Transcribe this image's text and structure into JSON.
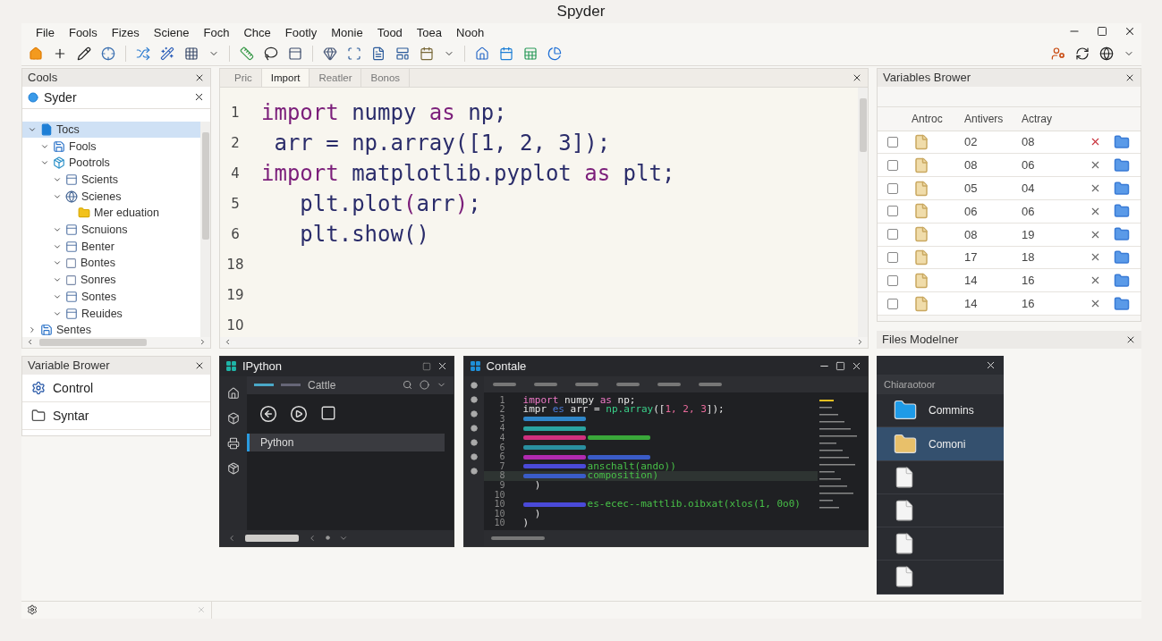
{
  "window": {
    "title": "Spyder"
  },
  "menu": [
    "File",
    "Fools",
    "Fizes",
    "Sciene",
    "Foch",
    "Chce",
    "Footly",
    "Monie",
    "Tood",
    "Toea",
    "Nooh"
  ],
  "tools_panel": {
    "title": "Cools",
    "tab": "Syder",
    "tree": [
      {
        "label": "Tocs",
        "kind": "file",
        "selected": true,
        "expanded": true,
        "children": [
          {
            "label": "Fools",
            "kind": "disk",
            "selected": false,
            "expanded": true
          },
          {
            "label": "Pootrols",
            "kind": "package",
            "selected": false,
            "expanded": true,
            "children": [
              {
                "label": "Scients",
                "kind": "panel",
                "selected": false,
                "expanded": true
              },
              {
                "label": "Scienes",
                "kind": "globe",
                "selected": false,
                "expanded": true,
                "children": [
                  {
                    "label": "Mer eduation",
                    "kind": "folder",
                    "selected": false
                  }
                ]
              },
              {
                "label": "Scnuions",
                "kind": "panel",
                "selected": false,
                "expanded": true
              },
              {
                "label": "Benter",
                "kind": "panel",
                "selected": false,
                "expanded": true
              },
              {
                "label": "Bontes",
                "kind": "blank",
                "selected": false,
                "expanded": true
              },
              {
                "label": "Sonres",
                "kind": "blank",
                "selected": false,
                "expanded": true
              },
              {
                "label": "Sontes",
                "kind": "panel",
                "selected": false,
                "expanded": true
              },
              {
                "label": "Reuides",
                "kind": "panel",
                "selected": false,
                "expanded": true
              }
            ]
          }
        ]
      },
      {
        "label": "Sentes",
        "kind": "disk",
        "selected": false,
        "expanded": false
      }
    ]
  },
  "editor": {
    "tabs": [
      {
        "label": "Pric",
        "selected": false
      },
      {
        "label": "Import",
        "selected": true
      },
      {
        "label": "Reatler",
        "selected": false
      },
      {
        "label": "Bonos",
        "selected": false
      }
    ],
    "lines": [
      {
        "num": "1",
        "tokens": [
          {
            "kind": "kw",
            "text": "import"
          },
          {
            "kind": "id",
            "text": " numpy "
          },
          {
            "kind": "kw",
            "text": "as"
          },
          {
            "kind": "id",
            "text": " np;"
          }
        ]
      },
      {
        "num": "2",
        "tokens": [
          {
            "kind": "id",
            "text": " arr = np.array([1, 2, 3]);"
          }
        ]
      },
      {
        "num": "4",
        "tokens": [
          {
            "kind": "kw",
            "text": "import"
          },
          {
            "kind": "id",
            "text": " matplotlib.pyplot "
          },
          {
            "kind": "kw",
            "text": "as"
          },
          {
            "kind": "id",
            "text": " plt;"
          }
        ]
      },
      {
        "num": "5",
        "tokens": [
          {
            "kind": "id",
            "text": "   plt.plot"
          },
          {
            "kind": "kw",
            "text": "("
          },
          {
            "kind": "id",
            "text": "arr"
          },
          {
            "kind": "kw",
            "text": ")"
          },
          {
            "kind": "id",
            "text": ";"
          }
        ]
      },
      {
        "num": "6",
        "tokens": [
          {
            "kind": "id",
            "text": "   plt.show()"
          }
        ]
      },
      {
        "num": "18"
      },
      {
        "num": "19"
      },
      {
        "num": "10"
      }
    ]
  },
  "variables": {
    "title": "Variables Brower",
    "columns": [
      "Antroc",
      "Antivers",
      "Actray"
    ],
    "rows": [
      {
        "checked": false,
        "value_1": "02",
        "value_2": "08",
        "delete_highlighted": true
      },
      {
        "checked": false,
        "value_1": "08",
        "value_2": "06",
        "delete_highlighted": false
      },
      {
        "checked": false,
        "value_1": "05",
        "value_2": "04",
        "delete_highlighted": false
      },
      {
        "checked": false,
        "value_1": "06",
        "value_2": "06",
        "delete_highlighted": false
      },
      {
        "checked": false,
        "value_1": "08",
        "value_2": "19",
        "delete_highlighted": false
      },
      {
        "checked": false,
        "value_1": "17",
        "value_2": "18",
        "delete_highlighted": false
      },
      {
        "checked": false,
        "value_1": "14",
        "value_2": "16",
        "delete_highlighted": false
      },
      {
        "checked": false,
        "value_1": "14",
        "value_2": "16",
        "delete_highlighted": false
      }
    ]
  },
  "files_panel": {
    "title": "Files Modelner",
    "path": "Chiaraotoor",
    "items": [
      {
        "kind": "folder",
        "label": "Commins",
        "color": "#1e9be8",
        "selected": false
      },
      {
        "kind": "folder",
        "label": "Comoni",
        "color": "#e8c06a",
        "selected": true
      },
      {
        "kind": "file",
        "selected": false
      },
      {
        "kind": "file",
        "selected": false
      },
      {
        "kind": "file",
        "selected": false
      },
      {
        "kind": "file",
        "selected": false
      }
    ]
  },
  "variable_panel": {
    "title": "Variable Brower",
    "items": [
      {
        "kind": "control",
        "label": "Control"
      },
      {
        "kind": "folder",
        "label": "Syntar"
      }
    ]
  },
  "ipython": {
    "title": "IPython",
    "tab": "Cattle",
    "items": [
      {
        "label": "Python",
        "selected": true
      }
    ]
  },
  "console": {
    "title": "Contale",
    "lines": [
      {
        "num": "1",
        "tokens": [
          {
            "kind": "kw",
            "text": "import"
          },
          {
            "kind": "id",
            "text": " numpy "
          },
          {
            "kind": "kw",
            "text": "as"
          },
          {
            "kind": "id",
            "text": " np;"
          }
        ]
      },
      {
        "num": "2",
        "tokens": [
          {
            "kind": "id",
            "text": "impr "
          },
          {
            "kind": "kw2",
            "text": "es"
          },
          {
            "kind": "id",
            "text": " arr = "
          },
          {
            "kind": "fn",
            "text": "np.array"
          },
          {
            "kind": "id",
            "text": "(["
          },
          {
            "kind": "num",
            "text": "1, 2, 3"
          },
          {
            "kind": "id",
            "text": "]);"
          }
        ]
      },
      {
        "num": "3",
        "tokens": [
          {
            "kind": "smudge",
            "color": "#2f86c8"
          }
        ]
      },
      {
        "num": "4",
        "tokens": [
          {
            "kind": "smudge",
            "color": "#2aa3a0"
          }
        ]
      },
      {
        "num": "4",
        "tokens": [
          {
            "kind": "smudge",
            "color": "#d0307e"
          },
          {
            "kind": "smudge",
            "color": "#3aa83a"
          }
        ]
      },
      {
        "num": "6",
        "tokens": [
          {
            "kind": "smudge",
            "color": "#2a8fa0"
          }
        ]
      },
      {
        "num": "6",
        "tokens": [
          {
            "kind": "smudge",
            "color": "#b02ab0"
          },
          {
            "kind": "smudge",
            "color": "#3a5cc8"
          }
        ]
      },
      {
        "num": "7",
        "tokens": [
          {
            "kind": "smudge",
            "color": "#4a4ad8"
          },
          {
            "kind": "str",
            "text": "anschalt(ando))"
          }
        ]
      },
      {
        "num": "8",
        "current": true,
        "tokens": [
          {
            "kind": "smudge",
            "color": "#3a5cc8"
          },
          {
            "kind": "str",
            "text": "composition)"
          }
        ]
      },
      {
        "num": "9",
        "tokens": [
          {
            "kind": "id",
            "text": "  )"
          }
        ]
      },
      {
        "num": "10"
      },
      {
        "num": "10",
        "tokens": [
          {
            "kind": "smudge",
            "color": "#4a4ad8"
          },
          {
            "kind": "str",
            "text": "es-ecec--mattlib.oibxat(xlos(1, 0o0)"
          }
        ]
      },
      {
        "num": "10",
        "tokens": [
          {
            "kind": "id",
            "text": "  )"
          }
        ]
      },
      {
        "num": "10",
        "tokens": [
          {
            "kind": "id",
            "text": ")"
          }
        ]
      }
    ]
  }
}
